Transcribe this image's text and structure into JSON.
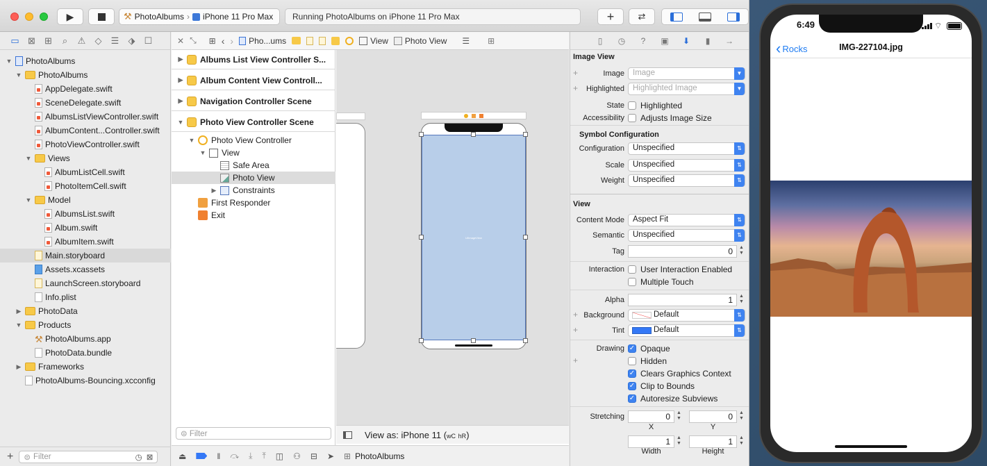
{
  "toolbar": {
    "scheme_app": "PhotoAlbums",
    "scheme_device": "iPhone 11 Pro Max",
    "status": "Running PhotoAlbums on iPhone 11 Pro Max"
  },
  "navigator": {
    "tree": [
      {
        "label": "PhotoAlbums",
        "indent": 0,
        "disc": "▼",
        "type": "proj"
      },
      {
        "label": "PhotoAlbums",
        "indent": 1,
        "disc": "▼",
        "type": "folder"
      },
      {
        "label": "AppDelegate.swift",
        "indent": 2,
        "disc": "",
        "type": "swift"
      },
      {
        "label": "SceneDelegate.swift",
        "indent": 2,
        "disc": "",
        "type": "swift"
      },
      {
        "label": "AlbumsListViewController.swift",
        "indent": 2,
        "disc": "",
        "type": "swift"
      },
      {
        "label": "AlbumContent...Controller.swift",
        "indent": 2,
        "disc": "",
        "type": "swift"
      },
      {
        "label": "PhotoViewController.swift",
        "indent": 2,
        "disc": "",
        "type": "swift"
      },
      {
        "label": "Views",
        "indent": 2,
        "disc": "▼",
        "type": "folder"
      },
      {
        "label": "AlbumListCell.swift",
        "indent": 3,
        "disc": "",
        "type": "swift"
      },
      {
        "label": "PhotoItemCell.swift",
        "indent": 3,
        "disc": "",
        "type": "swift"
      },
      {
        "label": "Model",
        "indent": 2,
        "disc": "▼",
        "type": "folder"
      },
      {
        "label": "AlbumsList.swift",
        "indent": 3,
        "disc": "",
        "type": "swift"
      },
      {
        "label": "Album.swift",
        "indent": 3,
        "disc": "",
        "type": "swift"
      },
      {
        "label": "AlbumItem.swift",
        "indent": 3,
        "disc": "",
        "type": "swift"
      },
      {
        "label": "Main.storyboard",
        "indent": 2,
        "disc": "",
        "type": "sb",
        "selected": true
      },
      {
        "label": "Assets.xcassets",
        "indent": 2,
        "disc": "",
        "type": "asset"
      },
      {
        "label": "LaunchScreen.storyboard",
        "indent": 2,
        "disc": "",
        "type": "sb"
      },
      {
        "label": "Info.plist",
        "indent": 2,
        "disc": "",
        "type": "file"
      },
      {
        "label": "PhotoData",
        "indent": 1,
        "disc": "▶",
        "type": "folder"
      },
      {
        "label": "Products",
        "indent": 1,
        "disc": "▼",
        "type": "folder"
      },
      {
        "label": "PhotoAlbums.app",
        "indent": 2,
        "disc": "",
        "type": "app"
      },
      {
        "label": "PhotoData.bundle",
        "indent": 2,
        "disc": "",
        "type": "file"
      },
      {
        "label": "Frameworks",
        "indent": 1,
        "disc": "▶",
        "type": "folder"
      },
      {
        "label": "PhotoAlbums-Bouncing.xcconfig",
        "indent": 1,
        "disc": "",
        "type": "file"
      }
    ],
    "filter_placeholder": "Filter"
  },
  "jumpbar": {
    "crumb_file": "Pho...ums",
    "crumb_view": "View",
    "crumb_photo": "Photo View"
  },
  "outline": {
    "scenes": [
      {
        "label": "Albums List View Controller S...",
        "disc": "▶"
      },
      {
        "label": "Album Content View Controll...",
        "disc": "▶"
      },
      {
        "label": "Navigation Controller Scene",
        "disc": "▶"
      },
      {
        "label": "Photo View Controller Scene",
        "disc": "▼"
      }
    ],
    "items": [
      {
        "label": "Photo View Controller",
        "indent": 1,
        "disc": "▼",
        "icon": "vc"
      },
      {
        "label": "View",
        "indent": 2,
        "disc": "▼",
        "icon": "view"
      },
      {
        "label": "Safe Area",
        "indent": 3,
        "disc": "",
        "icon": "safe"
      },
      {
        "label": "Photo View",
        "indent": 3,
        "disc": "",
        "icon": "img",
        "selected": true
      },
      {
        "label": "Constraints",
        "indent": 3,
        "disc": "▶",
        "icon": "cons"
      },
      {
        "label": "First Responder",
        "indent": 1,
        "disc": "",
        "icon": "fr"
      },
      {
        "label": "Exit",
        "indent": 1,
        "disc": "",
        "icon": "exit"
      }
    ],
    "filter_placeholder": "Filter"
  },
  "canvas": {
    "imageview_label": "UIImageView",
    "view_as": "View as: iPhone 11 (",
    "size_class_w": "wC",
    "size_class_h": "hR",
    "view_as_end": ")"
  },
  "ib_bottom": {
    "target": "PhotoAlbums"
  },
  "inspector": {
    "image_view_title": "Image View",
    "image_label": "Image",
    "image_placeholder": "Image",
    "highlighted_label": "Highlighted",
    "highlighted_placeholder": "Highlighted Image",
    "state_label": "State",
    "state_option": "Highlighted",
    "accessibility_label": "Accessibility",
    "accessibility_option": "Adjusts Image Size",
    "symbol_title": "Symbol Configuration",
    "configuration_label": "Configuration",
    "configuration_value": "Unspecified",
    "scale_label": "Scale",
    "scale_value": "Unspecified",
    "weight_label": "Weight",
    "weight_value": "Unspecified",
    "view_title": "View",
    "content_mode_label": "Content Mode",
    "content_mode_value": "Aspect Fit",
    "semantic_label": "Semantic",
    "semantic_value": "Unspecified",
    "tag_label": "Tag",
    "tag_value": "0",
    "interaction_label": "Interaction",
    "user_interaction": "User Interaction Enabled",
    "multiple_touch": "Multiple Touch",
    "alpha_label": "Alpha",
    "alpha_value": "1",
    "background_label": "Background",
    "background_value": "Default",
    "tint_label": "Tint",
    "tint_value": "Default",
    "tint_color": "#3478f6",
    "drawing_label": "Drawing",
    "opaque": "Opaque",
    "hidden": "Hidden",
    "clears": "Clears Graphics Context",
    "clip": "Clip to Bounds",
    "autoresize": "Autoresize Subviews",
    "stretching_label": "Stretching",
    "stretch_x": "0",
    "stretch_y": "0",
    "x_label": "X",
    "y_label": "Y",
    "stretch_w": "1",
    "stretch_h": "1",
    "width_label": "Width",
    "height_label": "Height"
  },
  "simulator": {
    "time": "6:49",
    "back_label": "Rocks",
    "title": "IMG-227104.jpg"
  }
}
